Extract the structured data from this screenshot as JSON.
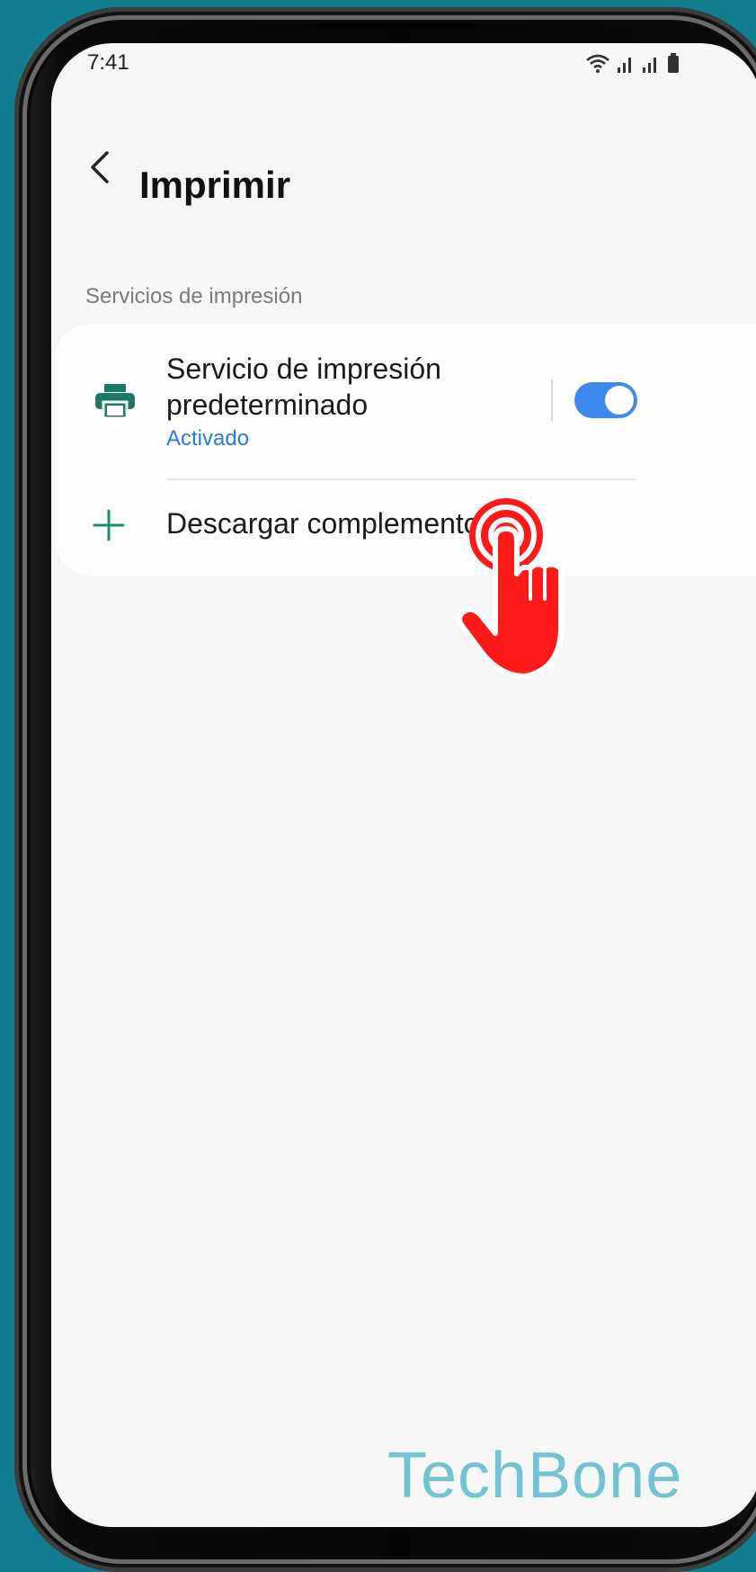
{
  "status_bar": {
    "time": "7:41",
    "icons": [
      "wifi-icon",
      "signal-icon",
      "signal-icon",
      "battery-icon"
    ]
  },
  "header": {
    "back_icon": "chevron-left-icon",
    "title": "Imprimir"
  },
  "section": {
    "label": "Servicios de impresión"
  },
  "services": {
    "default_service": {
      "icon": "printer-icon",
      "title": "Servicio de impresión predeterminado",
      "status": "Activado",
      "toggle_on": true
    },
    "download_plugin": {
      "icon": "plus-icon",
      "label": "Descargar complemento"
    }
  },
  "watermark": "TechBone",
  "colors": {
    "background": "#127d8e",
    "screen": "#f6f6f6",
    "accent_blue": "#3d89f0",
    "status_blue": "#2a7bd4",
    "icon_green": "#1a7a64",
    "pointer_red": "#ff1a1a",
    "watermark": "#72c4d3"
  }
}
